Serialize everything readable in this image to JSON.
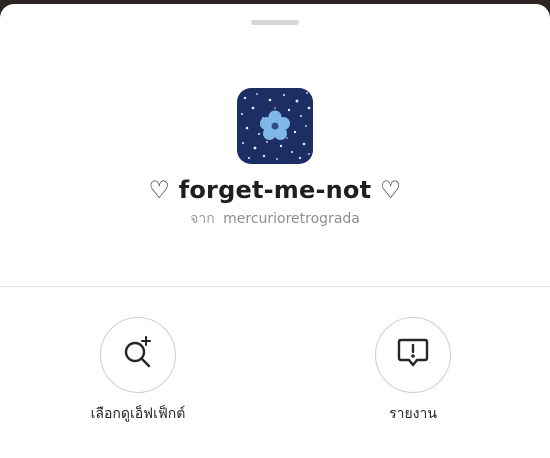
{
  "effect": {
    "title": "♡ forget-me-not ♡",
    "creator_prefix": "จาก",
    "creator_name": "mercurioretrograda",
    "thumbnail": {
      "background": "#1c2e63",
      "flower": "#7fb8e8",
      "sparkle": "#e8eef8"
    }
  },
  "actions": [
    {
      "label": "เลือกดูเอ็ฟเฟ็กต์",
      "icon": "search-sparkle-icon"
    },
    {
      "label": "รายงาน",
      "icon": "report-icon"
    }
  ],
  "colors": {
    "sheet": "#ffffff",
    "text": "#1f1f1f",
    "muted": "#9b9b9b",
    "border": "#cfcfcf"
  }
}
